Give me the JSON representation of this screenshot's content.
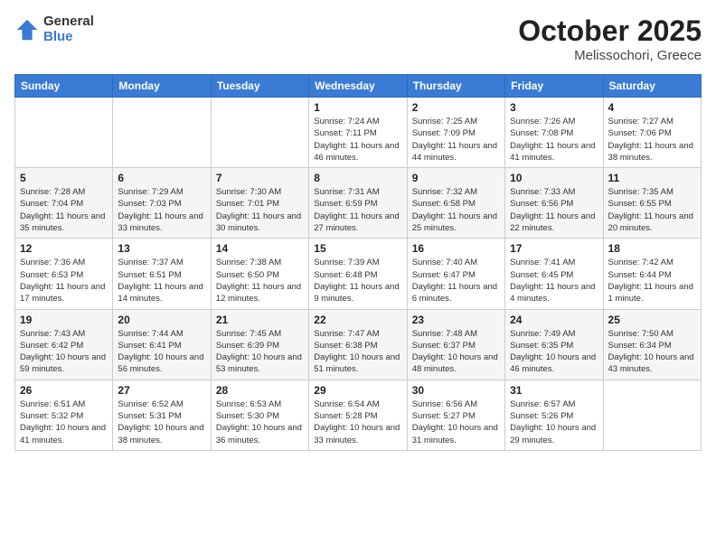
{
  "header": {
    "logo_general": "General",
    "logo_blue": "Blue",
    "month_title": "October 2025",
    "location": "Melissochori, Greece"
  },
  "days_of_week": [
    "Sunday",
    "Monday",
    "Tuesday",
    "Wednesday",
    "Thursday",
    "Friday",
    "Saturday"
  ],
  "weeks": [
    [
      {
        "day": "",
        "sunrise": "",
        "sunset": "",
        "daylight": ""
      },
      {
        "day": "",
        "sunrise": "",
        "sunset": "",
        "daylight": ""
      },
      {
        "day": "",
        "sunrise": "",
        "sunset": "",
        "daylight": ""
      },
      {
        "day": "1",
        "sunrise": "Sunrise: 7:24 AM",
        "sunset": "Sunset: 7:11 PM",
        "daylight": "Daylight: 11 hours and 46 minutes."
      },
      {
        "day": "2",
        "sunrise": "Sunrise: 7:25 AM",
        "sunset": "Sunset: 7:09 PM",
        "daylight": "Daylight: 11 hours and 44 minutes."
      },
      {
        "day": "3",
        "sunrise": "Sunrise: 7:26 AM",
        "sunset": "Sunset: 7:08 PM",
        "daylight": "Daylight: 11 hours and 41 minutes."
      },
      {
        "day": "4",
        "sunrise": "Sunrise: 7:27 AM",
        "sunset": "Sunset: 7:06 PM",
        "daylight": "Daylight: 11 hours and 38 minutes."
      }
    ],
    [
      {
        "day": "5",
        "sunrise": "Sunrise: 7:28 AM",
        "sunset": "Sunset: 7:04 PM",
        "daylight": "Daylight: 11 hours and 35 minutes."
      },
      {
        "day": "6",
        "sunrise": "Sunrise: 7:29 AM",
        "sunset": "Sunset: 7:03 PM",
        "daylight": "Daylight: 11 hours and 33 minutes."
      },
      {
        "day": "7",
        "sunrise": "Sunrise: 7:30 AM",
        "sunset": "Sunset: 7:01 PM",
        "daylight": "Daylight: 11 hours and 30 minutes."
      },
      {
        "day": "8",
        "sunrise": "Sunrise: 7:31 AM",
        "sunset": "Sunset: 6:59 PM",
        "daylight": "Daylight: 11 hours and 27 minutes."
      },
      {
        "day": "9",
        "sunrise": "Sunrise: 7:32 AM",
        "sunset": "Sunset: 6:58 PM",
        "daylight": "Daylight: 11 hours and 25 minutes."
      },
      {
        "day": "10",
        "sunrise": "Sunrise: 7:33 AM",
        "sunset": "Sunset: 6:56 PM",
        "daylight": "Daylight: 11 hours and 22 minutes."
      },
      {
        "day": "11",
        "sunrise": "Sunrise: 7:35 AM",
        "sunset": "Sunset: 6:55 PM",
        "daylight": "Daylight: 11 hours and 20 minutes."
      }
    ],
    [
      {
        "day": "12",
        "sunrise": "Sunrise: 7:36 AM",
        "sunset": "Sunset: 6:53 PM",
        "daylight": "Daylight: 11 hours and 17 minutes."
      },
      {
        "day": "13",
        "sunrise": "Sunrise: 7:37 AM",
        "sunset": "Sunset: 6:51 PM",
        "daylight": "Daylight: 11 hours and 14 minutes."
      },
      {
        "day": "14",
        "sunrise": "Sunrise: 7:38 AM",
        "sunset": "Sunset: 6:50 PM",
        "daylight": "Daylight: 11 hours and 12 minutes."
      },
      {
        "day": "15",
        "sunrise": "Sunrise: 7:39 AM",
        "sunset": "Sunset: 6:48 PM",
        "daylight": "Daylight: 11 hours and 9 minutes."
      },
      {
        "day": "16",
        "sunrise": "Sunrise: 7:40 AM",
        "sunset": "Sunset: 6:47 PM",
        "daylight": "Daylight: 11 hours and 6 minutes."
      },
      {
        "day": "17",
        "sunrise": "Sunrise: 7:41 AM",
        "sunset": "Sunset: 6:45 PM",
        "daylight": "Daylight: 11 hours and 4 minutes."
      },
      {
        "day": "18",
        "sunrise": "Sunrise: 7:42 AM",
        "sunset": "Sunset: 6:44 PM",
        "daylight": "Daylight: 11 hours and 1 minute."
      }
    ],
    [
      {
        "day": "19",
        "sunrise": "Sunrise: 7:43 AM",
        "sunset": "Sunset: 6:42 PM",
        "daylight": "Daylight: 10 hours and 59 minutes."
      },
      {
        "day": "20",
        "sunrise": "Sunrise: 7:44 AM",
        "sunset": "Sunset: 6:41 PM",
        "daylight": "Daylight: 10 hours and 56 minutes."
      },
      {
        "day": "21",
        "sunrise": "Sunrise: 7:45 AM",
        "sunset": "Sunset: 6:39 PM",
        "daylight": "Daylight: 10 hours and 53 minutes."
      },
      {
        "day": "22",
        "sunrise": "Sunrise: 7:47 AM",
        "sunset": "Sunset: 6:38 PM",
        "daylight": "Daylight: 10 hours and 51 minutes."
      },
      {
        "day": "23",
        "sunrise": "Sunrise: 7:48 AM",
        "sunset": "Sunset: 6:37 PM",
        "daylight": "Daylight: 10 hours and 48 minutes."
      },
      {
        "day": "24",
        "sunrise": "Sunrise: 7:49 AM",
        "sunset": "Sunset: 6:35 PM",
        "daylight": "Daylight: 10 hours and 46 minutes."
      },
      {
        "day": "25",
        "sunrise": "Sunrise: 7:50 AM",
        "sunset": "Sunset: 6:34 PM",
        "daylight": "Daylight: 10 hours and 43 minutes."
      }
    ],
    [
      {
        "day": "26",
        "sunrise": "Sunrise: 6:51 AM",
        "sunset": "Sunset: 5:32 PM",
        "daylight": "Daylight: 10 hours and 41 minutes."
      },
      {
        "day": "27",
        "sunrise": "Sunrise: 6:52 AM",
        "sunset": "Sunset: 5:31 PM",
        "daylight": "Daylight: 10 hours and 38 minutes."
      },
      {
        "day": "28",
        "sunrise": "Sunrise: 6:53 AM",
        "sunset": "Sunset: 5:30 PM",
        "daylight": "Daylight: 10 hours and 36 minutes."
      },
      {
        "day": "29",
        "sunrise": "Sunrise: 6:54 AM",
        "sunset": "Sunset: 5:28 PM",
        "daylight": "Daylight: 10 hours and 33 minutes."
      },
      {
        "day": "30",
        "sunrise": "Sunrise: 6:56 AM",
        "sunset": "Sunset: 5:27 PM",
        "daylight": "Daylight: 10 hours and 31 minutes."
      },
      {
        "day": "31",
        "sunrise": "Sunrise: 6:57 AM",
        "sunset": "Sunset: 5:26 PM",
        "daylight": "Daylight: 10 hours and 29 minutes."
      },
      {
        "day": "",
        "sunrise": "",
        "sunset": "",
        "daylight": ""
      }
    ]
  ]
}
